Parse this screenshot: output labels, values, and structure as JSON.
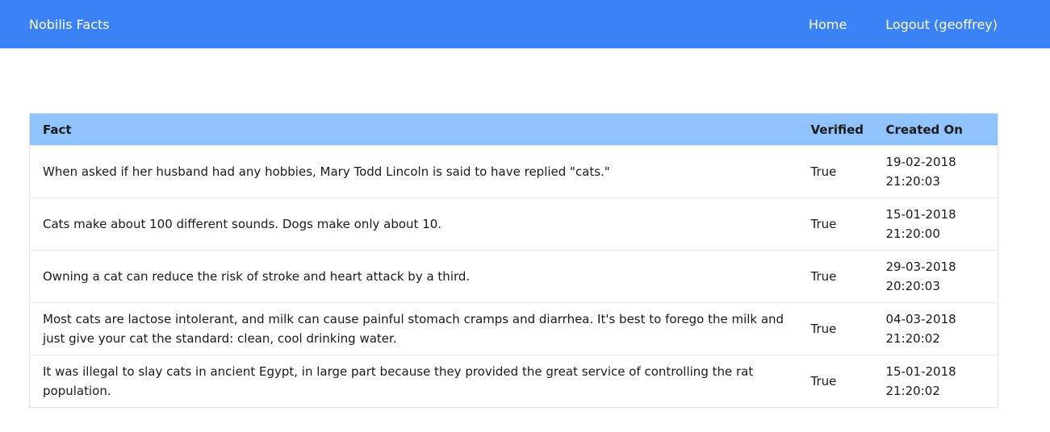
{
  "navbar": {
    "brand": "Nobilis Facts",
    "links": [
      {
        "label": "Home"
      },
      {
        "label": "Logout (geoffrey)"
      }
    ],
    "bg_color": "#3b82f6"
  },
  "table": {
    "header_color": "#90c2fb",
    "columns": [
      "Fact",
      "Verified",
      "Created On"
    ],
    "rows": [
      {
        "fact": "When asked if her husband had any hobbies, Mary Todd Lincoln is said to have replied \"cats.\"",
        "verified": "True",
        "created_date": "19-02-2018",
        "created_time": "21:20:03"
      },
      {
        "fact": "Cats make about 100 different sounds. Dogs make only about 10.",
        "verified": "True",
        "created_date": "15-01-2018",
        "created_time": "21:20:00"
      },
      {
        "fact": "Owning a cat can reduce the risk of stroke and heart attack by a third.",
        "verified": "True",
        "created_date": "29-03-2018",
        "created_time": "20:20:03"
      },
      {
        "fact": "Most cats are lactose intolerant, and milk can cause painful stomach cramps and diarrhea. It's best to forego the milk and just give your cat the standard: clean, cool drinking water.",
        "verified": "True",
        "created_date": "04-03-2018",
        "created_time": "21:20:02"
      },
      {
        "fact": "It was illegal to slay cats in ancient Egypt, in large part because they provided the great service of controlling the rat population.",
        "verified": "True",
        "created_date": "15-01-2018",
        "created_time": "21:20:02"
      }
    ]
  }
}
